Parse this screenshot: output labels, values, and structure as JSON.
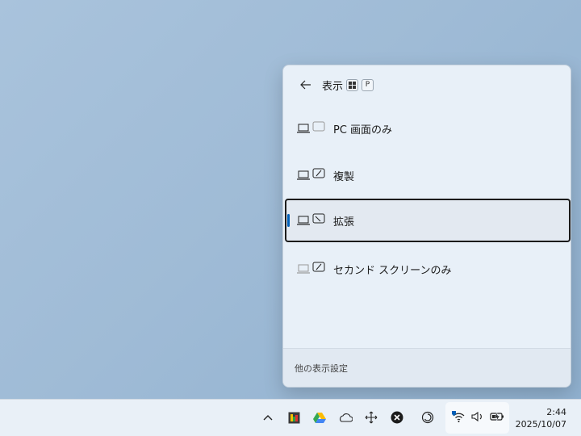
{
  "flyout": {
    "title": "表示",
    "shortcut_keys": [
      "⊞",
      "P"
    ],
    "options": [
      {
        "label": "PC 画面のみ",
        "icon": "pc-screen-only-icon",
        "selected": false
      },
      {
        "label": "複製",
        "icon": "duplicate-icon",
        "selected": false
      },
      {
        "label": "拡張",
        "icon": "extend-icon",
        "selected": true
      },
      {
        "label": "セカンド スクリーンのみ",
        "icon": "second-screen-only-icon",
        "selected": false
      }
    ],
    "footer_link": "他の表示設定"
  },
  "taskbar": {
    "time": "2:44",
    "date": "2025/10/07",
    "tray_icons": [
      "chevron-up-icon",
      "app-icon",
      "google-drive-icon",
      "onedrive-icon",
      "move-icon",
      "close-circle-icon",
      "sync-icon"
    ],
    "quick_icons": [
      "wifi-icon",
      "volume-icon",
      "battery-icon"
    ]
  },
  "colors": {
    "accent": "#005fb8",
    "flyout_bg": "#e8f0f8"
  }
}
